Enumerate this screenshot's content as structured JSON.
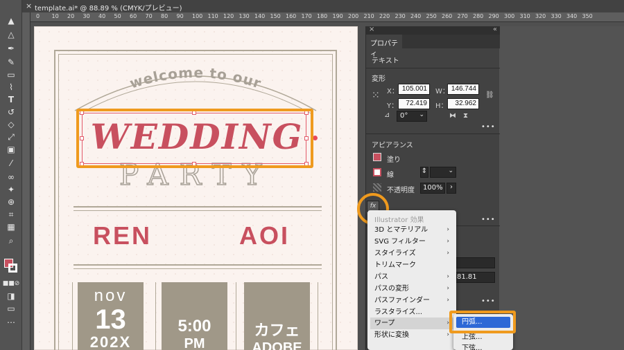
{
  "colors": {
    "accent": "#ef9a1e",
    "wedding_red": "#c8505f",
    "card_taupe": "#a09888",
    "menu_selected": "#2d68d6"
  },
  "window": {
    "tab_close": "×",
    "doc_title": "template.ai* @ 88.89 % (CMYK/プレビュー)"
  },
  "ruler": {
    "ticks": [
      "0",
      "10",
      "20",
      "30",
      "40",
      "50",
      "60",
      "70",
      "80",
      "90",
      "100",
      "110",
      "120",
      "130",
      "140",
      "150",
      "160",
      "170",
      "180",
      "190",
      "200",
      "210",
      "220",
      "230",
      "240",
      "250",
      "260",
      "270",
      "280",
      "290",
      "300",
      "310",
      "320",
      "330",
      "340",
      "350"
    ]
  },
  "toolbar": {
    "tools": [
      "selection-tool-icon",
      "direct-selection-tool-icon",
      "pen-tool-icon",
      "pencil-tool-icon",
      "rectangle-tool-icon",
      "paintbrush-tool-icon",
      "type-tool-icon",
      "rotate-tool-icon",
      "eraser-tool-icon",
      "scale-tool-icon",
      "gradient-tool-icon",
      "eyedropper-tool-icon",
      "blend-tool-icon",
      "symbol-sprayer-icon",
      "shape-builder-icon",
      "artboard-tool-icon",
      "graph-tool-icon",
      "hand-tool-icon",
      "zoom-tool-icon"
    ]
  },
  "artboard": {
    "welcome": "welcome to our",
    "wedding": "WEDDING",
    "party": "PARTY",
    "name_left": "REN",
    "name_right": "AOI",
    "cards": [
      {
        "line1": "nov",
        "line2": "13",
        "line3": "202X"
      },
      {
        "line1": "",
        "line2": "5:00",
        "line3": "PM"
      },
      {
        "line1": "",
        "line2": "カフェ",
        "line3": "ADOBE"
      }
    ]
  },
  "panel": {
    "collapse": "«",
    "close": "×",
    "tab": "プロパティ",
    "section_text": "テキスト",
    "section_transform": "変形",
    "x_label": "X：",
    "x_value": "105.001",
    "y_label": "Y：",
    "y_value": "72.419",
    "w_label": "W：",
    "w_value": "146.744",
    "h_label": "H：",
    "h_value": "32.962",
    "angle_value": "0°",
    "section_appearance": "アピアランス",
    "fill_label": "塗り",
    "stroke_label": "線",
    "opacity_label": "不透明度",
    "opacity_value": "100%",
    "more": "•••",
    "hidden_value": "81.81",
    "fx_label": "fx"
  },
  "menu": {
    "header": "Illustrator 効果",
    "items": [
      {
        "label": "3D とマテリアル",
        "arrow": "›"
      },
      {
        "label": "SVG フィルター",
        "arrow": "›"
      },
      {
        "label": "スタイライズ",
        "arrow": "›"
      },
      {
        "label": "トリムマーク",
        "arrow": ""
      },
      {
        "label": "パス",
        "arrow": "›"
      },
      {
        "label": "パスの変形",
        "arrow": "›"
      },
      {
        "label": "パスファインダー",
        "arrow": "›"
      },
      {
        "label": "ラスタライズ...",
        "arrow": ""
      },
      {
        "label": "ワープ",
        "arrow": "›"
      },
      {
        "label": "形状に変換",
        "arrow": "›"
      }
    ]
  },
  "submenu": {
    "items": [
      "円弧...",
      "上弦...",
      "下弦..."
    ]
  }
}
